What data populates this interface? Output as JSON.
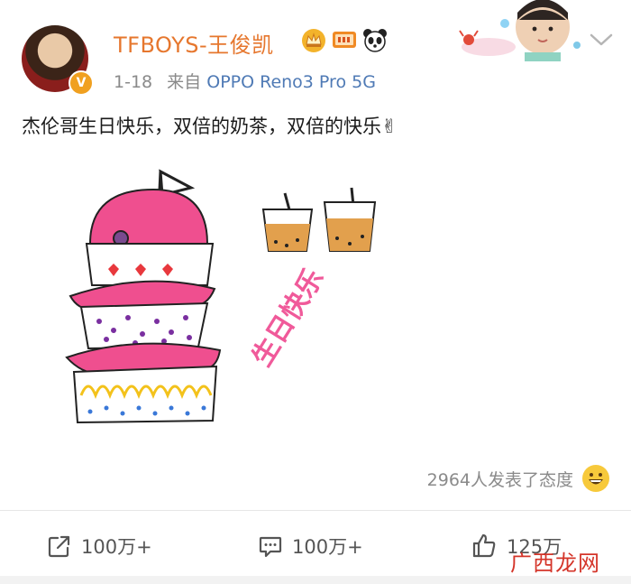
{
  "user": {
    "name": "TFBOYS-王俊凯",
    "verified_icon": "v-badge-icon",
    "badges": [
      "crown-icon",
      "movie-icon",
      "panda-icon"
    ]
  },
  "meta": {
    "time": "1-18",
    "source_prefix": "来自",
    "device": "OPPO Reno3 Pro 5G"
  },
  "post": {
    "text": "杰伦哥生日快乐，双倍的奶茶，双倍的快乐✌",
    "illustration_text": "生日快乐"
  },
  "reactions": {
    "summary": "2964人发表了态度",
    "emoji": "grinning-face-icon"
  },
  "actions": {
    "share_count": "100万+",
    "comment_count": "100万+",
    "like_count": "125万"
  },
  "watermark": "广西龙网",
  "colors": {
    "username": "#e6772e",
    "device": "#4f7ab5",
    "muted": "#8a8a8a",
    "cake_pink": "#f05a9a",
    "watermark": "#d22a1e"
  }
}
